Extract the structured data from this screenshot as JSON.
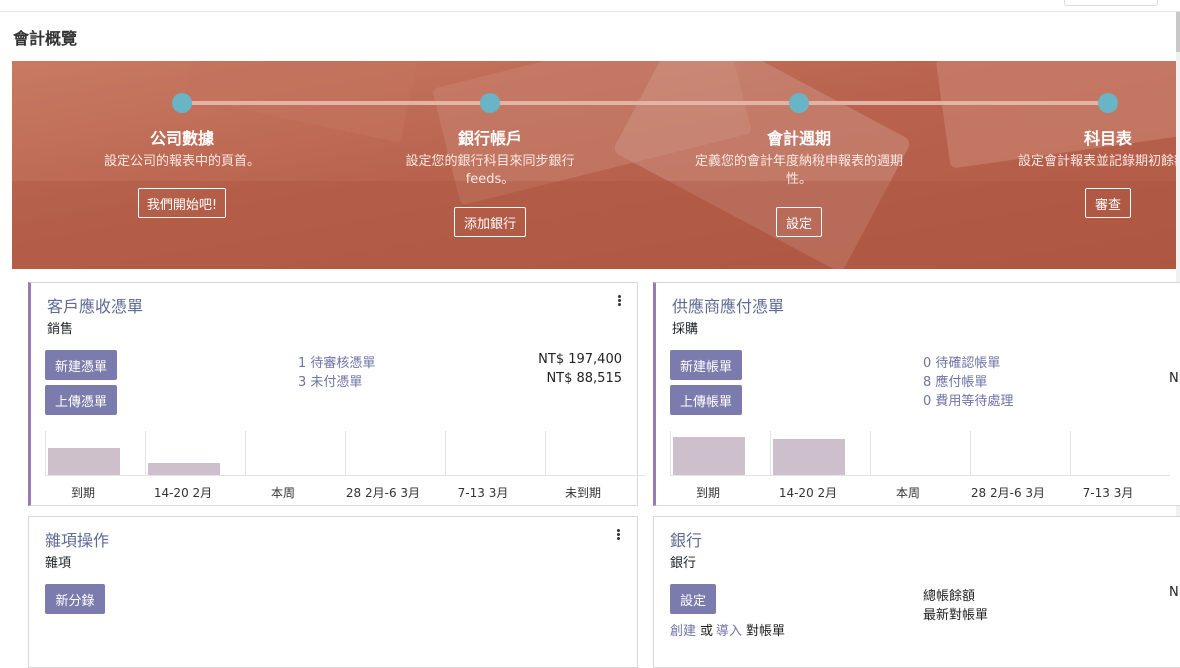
{
  "page_title": "會計概覽",
  "onboarding": {
    "steps": [
      {
        "title": "公司數據",
        "desc": "設定公司的報表中的頁首。",
        "button": "我們開始吧!"
      },
      {
        "title": "銀行帳戶",
        "desc": "設定您的銀行科目來同步銀行 feeds。",
        "button": "添加銀行"
      },
      {
        "title": "會計週期",
        "desc": "定義您的會計年度納稅申報表的週期性。",
        "button": "設定"
      },
      {
        "title": "科目表",
        "desc": "設定會計報表並記錄期初餘額",
        "button": "審查"
      }
    ]
  },
  "colors": {
    "accent": "#9a7bb3",
    "primary_button": "#7c7bad",
    "step_dot": "#69b4c5",
    "banner": "#b9634e"
  },
  "cards": {
    "sales": {
      "title": "客戶應收憑單",
      "subtitle": "銷售",
      "buttons": [
        "新建憑單",
        "上傳憑單"
      ],
      "links": [
        "1 待審核憑單",
        "3 未付憑單"
      ],
      "amounts": [
        "NT$ 197,400",
        "NT$ 88,515"
      ],
      "chart": {
        "type": "bar",
        "categories": [
          "到期",
          "14-20 2月",
          "本周",
          "28 2月-6 3月",
          "7-13 3月",
          "未到期"
        ],
        "values": [
          0.62,
          0.27,
          0,
          0,
          0,
          0
        ]
      }
    },
    "purchase": {
      "title": "供應商應付憑單",
      "subtitle": "採購",
      "buttons": [
        "新建帳單",
        "上傳帳單"
      ],
      "links": [
        "0 待確認帳單",
        "8 應付帳單",
        "0 費用等待處理"
      ],
      "amount_clipped": "N",
      "chart": {
        "type": "bar",
        "categories": [
          "到期",
          "14-20 2月",
          "本周",
          "28 2月-6 3月",
          "7-13 3月"
        ],
        "values": [
          0.86,
          0.82,
          0,
          0,
          0
        ]
      }
    },
    "misc": {
      "title": "雜項操作",
      "subtitle": "雜項",
      "button": "新分錄"
    },
    "bank": {
      "title": "銀行",
      "subtitle": "銀行",
      "button": "設定",
      "create_link": "創建",
      "or": "或",
      "import_link": "導入",
      "statement": "對帳單",
      "balance_label": "總帳餘額",
      "last_statement": "最新對帳單",
      "amount_clipped": "N"
    }
  }
}
